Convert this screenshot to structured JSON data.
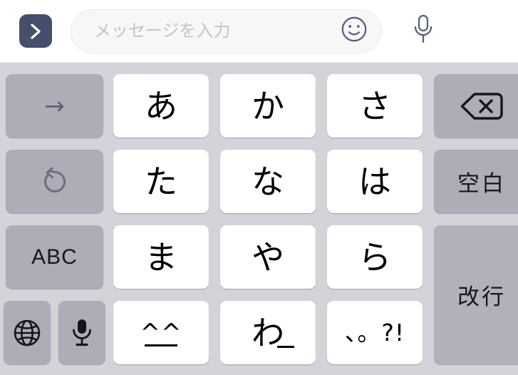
{
  "compose": {
    "send_label": "send-arrow",
    "send_color": "#454f6b",
    "input_value": "",
    "input_placeholder": "メッセージを入力",
    "emoji_icon": "smiley-face-icon",
    "mic_icon": "microphone-icon"
  },
  "keyboard": {
    "background_color": "#d3d3d9",
    "kana_key_color": "#ffffff",
    "function_key_color": "#adadb7",
    "rows": [
      {
        "keys": [
          {
            "name": "cursor-right-key",
            "label": "→",
            "type": "func"
          },
          {
            "name": "kana-key-a",
            "label": "あ",
            "type": "kana"
          },
          {
            "name": "kana-key-ka",
            "label": "か",
            "type": "kana"
          },
          {
            "name": "kana-key-sa",
            "label": "さ",
            "type": "kana"
          },
          {
            "name": "delete-key",
            "label": "⌫",
            "type": "func"
          }
        ]
      },
      {
        "keys": [
          {
            "name": "undo-key",
            "label": "↺",
            "type": "func"
          },
          {
            "name": "kana-key-ta",
            "label": "た",
            "type": "kana"
          },
          {
            "name": "kana-key-na",
            "label": "な",
            "type": "kana"
          },
          {
            "name": "kana-key-ha",
            "label": "は",
            "type": "kana"
          },
          {
            "name": "space-key",
            "label": "空白",
            "type": "func"
          }
        ]
      },
      {
        "keys": [
          {
            "name": "abc-key",
            "label": "ABC",
            "type": "func"
          },
          {
            "name": "kana-key-ma",
            "label": "ま",
            "type": "kana"
          },
          {
            "name": "kana-key-ya",
            "label": "や",
            "type": "kana"
          },
          {
            "name": "kana-key-ra",
            "label": "ら",
            "type": "kana"
          },
          {
            "name": "return-key",
            "label": "改行",
            "type": "func"
          }
        ]
      },
      {
        "keys": [
          {
            "name": "globe-key",
            "label": "🌐",
            "type": "func"
          },
          {
            "name": "dictation-key",
            "label": "🎤",
            "type": "func"
          },
          {
            "name": "kaomoji-key",
            "label": "^_^",
            "type": "kana"
          },
          {
            "name": "kana-key-wa",
            "label": "わ_",
            "type": "kana"
          },
          {
            "name": "punctuation-key",
            "label": "、。?!",
            "type": "kana"
          }
        ]
      }
    ],
    "labels": {
      "cursor_right": "→",
      "undo": "undo-arrow-icon",
      "abc": "ABC",
      "globe": "globe-icon",
      "dictation": "microphone-icon",
      "delete": "delete-backspace-icon",
      "space": "空白",
      "return": "改行",
      "kaomoji": "^^",
      "kana_a": "あ",
      "kana_ka": "か",
      "kana_sa": "さ",
      "kana_ta": "た",
      "kana_na": "な",
      "kana_ha": "は",
      "kana_ma": "ま",
      "kana_ya": "や",
      "kana_ra": "ら",
      "kana_wa": "わ",
      "kana_wa_underscore": "_",
      "punctuation": "、。?!"
    }
  }
}
